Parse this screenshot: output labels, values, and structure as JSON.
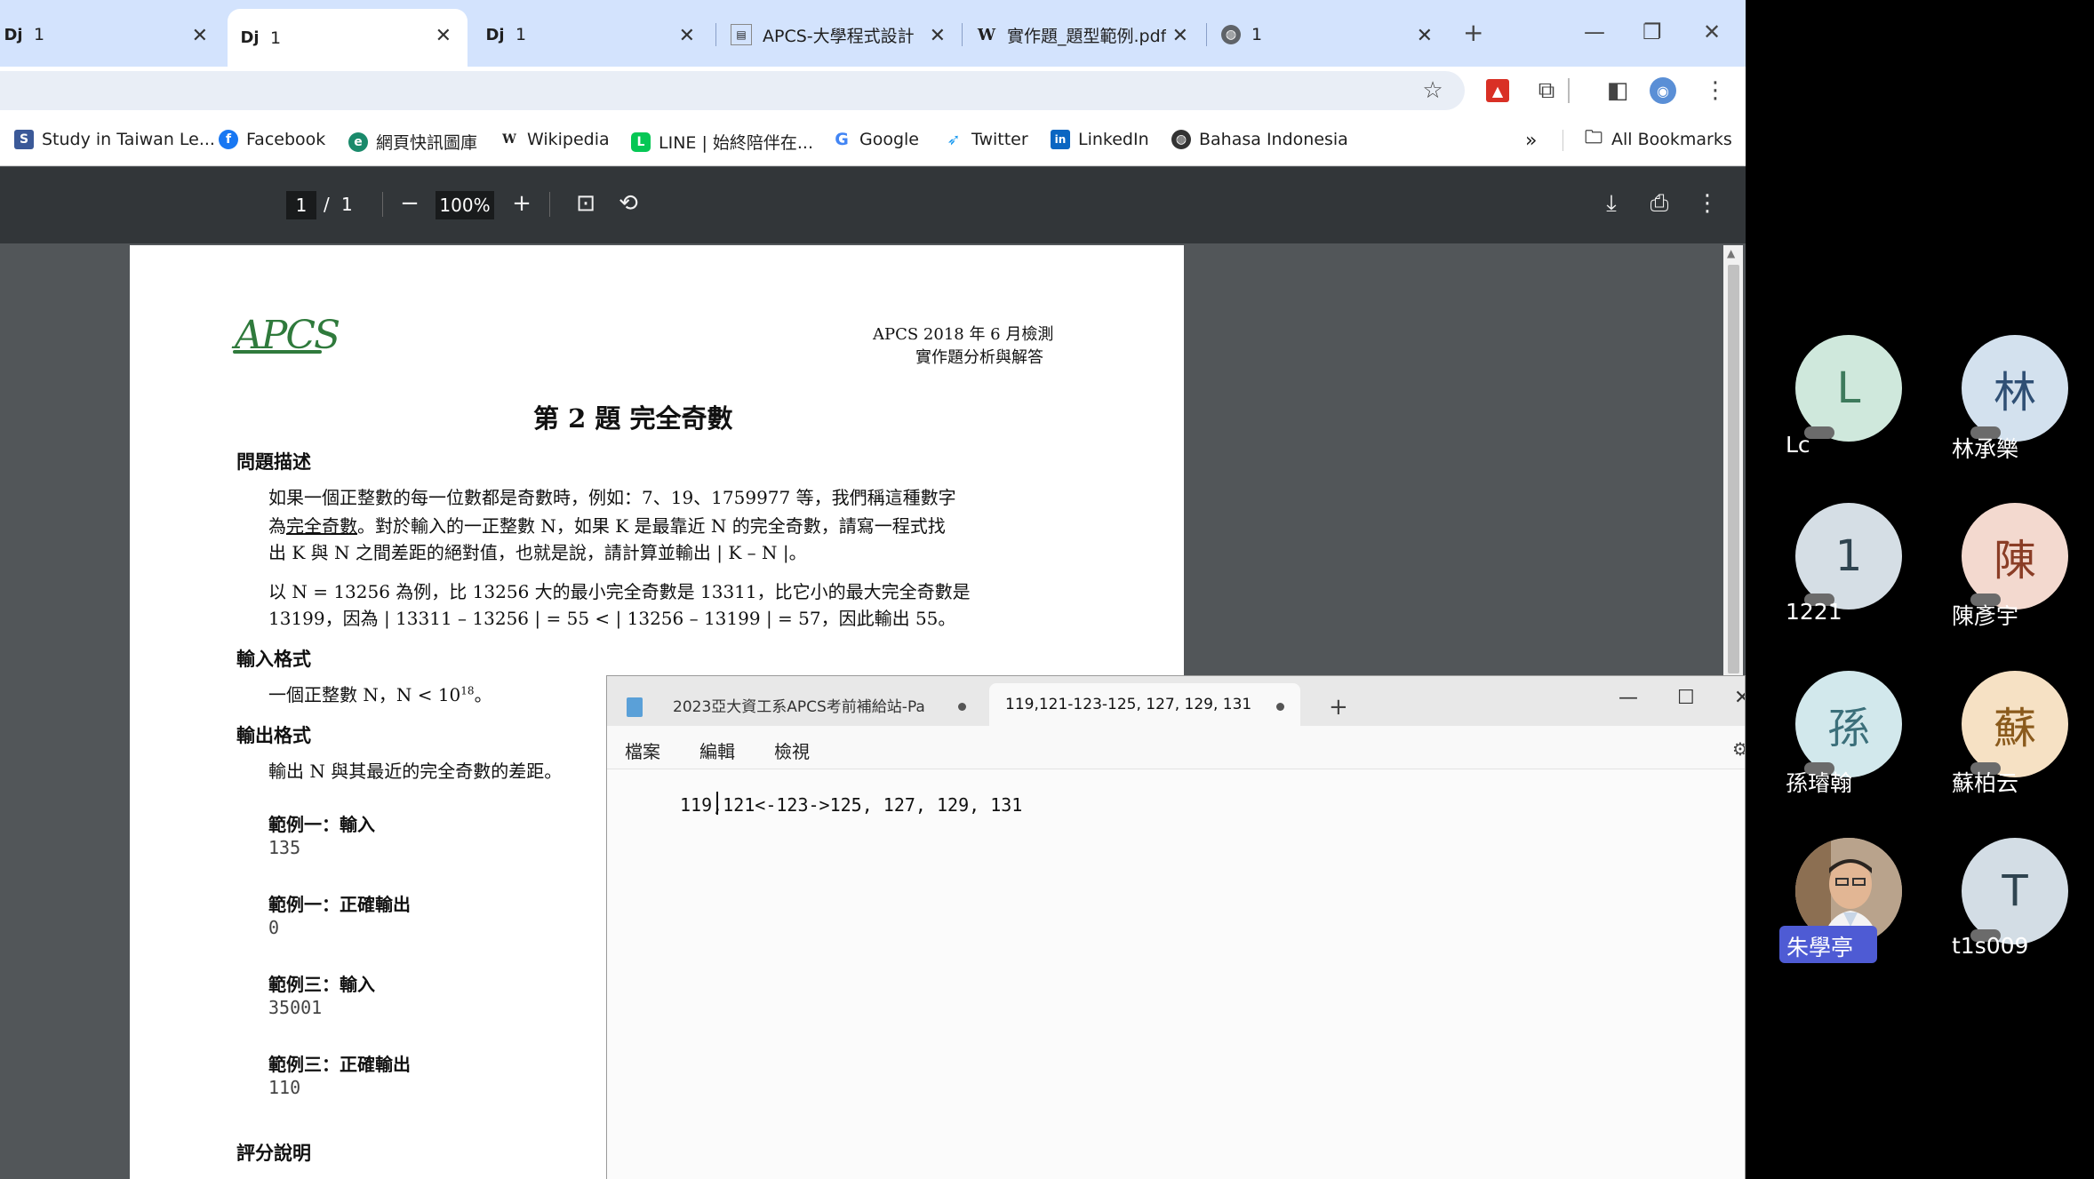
{
  "browser": {
    "tabs": [
      {
        "label": "1",
        "icon": "django-icon"
      },
      {
        "label": "1",
        "icon": "django-icon",
        "active": true
      },
      {
        "label": "1",
        "icon": "django-icon"
      },
      {
        "label": "APCS-大學程式設計",
        "icon": "apcs-icon"
      },
      {
        "label": "實作題_題型範例.pdf",
        "icon": "wordpress-icon"
      },
      {
        "label": "1",
        "icon": "globe-icon"
      }
    ],
    "new_tab": "+",
    "bookmarks": [
      {
        "label": "Study in Taiwan Le...",
        "icon": "study-icon"
      },
      {
        "label": "Facebook",
        "icon": "facebook-icon"
      },
      {
        "label": "網頁快訊圖庫",
        "icon": "edge-icon"
      },
      {
        "label": "Wikipedia",
        "icon": "wikipedia-icon"
      },
      {
        "label": "LINE | 始終陪伴在...",
        "icon": "line-icon"
      },
      {
        "label": "Google",
        "icon": "google-icon"
      },
      {
        "label": "Twitter",
        "icon": "twitter-icon"
      },
      {
        "label": "LinkedIn",
        "icon": "linkedin-icon"
      },
      {
        "label": "Bahasa Indonesia",
        "icon": "globe-icon"
      }
    ],
    "bookmarks_more": "»",
    "all_bookmarks": "All Bookmarks"
  },
  "pdf_viewer": {
    "page_current": "1",
    "page_sep": "/",
    "page_total": "1",
    "zoom": "100%"
  },
  "pdf": {
    "logo": "APCS",
    "header_line1": "APCS 2018 年 6 月檢測",
    "header_line2": "實作題分析與解答",
    "title": "第 2 題  完全奇數",
    "h_problem": "問題描述",
    "p1_line1": "如果一個正整數的每一位數都是奇數時，例如：7、19、1759977 等，我們稱這種數字",
    "p1_line2_a": "為",
    "p1_line2_u": "完全奇數",
    "p1_line2_b": "。對於輸入的一正整數 N，如果 K 是最靠近 N 的完全奇數，請寫一程式找",
    "p1_line3": "出 K 與 N 之間差距的絕對值，也就是說，請計算並輸出 | K – N |。",
    "p2_line1": "以 N = 13256 為例，比 13256 大的最小完全奇數是 13311，比它小的最大完全奇數是",
    "p2_line2": "13199，因為 | 13311 – 13256 | = 55 < | 13256 – 13199 | = 57，因此輸出 55。",
    "h_input": "輸入格式",
    "input_desc_a": "一個正整數 N，N < 10",
    "input_desc_sup": "18",
    "input_desc_b": "。",
    "h_output": "輸出格式",
    "output_desc": "輸出 N 與其最近的完全奇數的差距。",
    "ex1_in_label": "範例一：輸入",
    "ex1_in": "135",
    "ex1_out_label": "範例一：正確輸出",
    "ex1_out": "0",
    "ex3_in_label": "範例三：輸入",
    "ex3_in": "35001",
    "ex3_out_label": "範例三：正確輸出",
    "ex3_out": "110",
    "h_scoring": "評分說明"
  },
  "notepad": {
    "tab1": "2023亞大資工系APCS考前補給站-Pa",
    "tab2": "119,121-123-125, 127, 129, 131",
    "new_tab": "+",
    "menu": [
      "檔案",
      "編輯",
      "檢視"
    ],
    "content": "119,121<-123->125, 127, 129, 131"
  },
  "participants": [
    {
      "name": "Lc",
      "initial": "L",
      "bg": "#cfe8dc",
      "fg": "#3d7a5c"
    },
    {
      "name": "林承樂",
      "initial": "林",
      "bg": "#d3e1ee",
      "fg": "#2f4f74"
    },
    {
      "name": "1221",
      "initial": "1",
      "bg": "#d5dee5",
      "fg": "#2f4450"
    },
    {
      "name": "陳彥宇",
      "initial": "陳",
      "bg": "#f3d9cf",
      "fg": "#8a3d26"
    },
    {
      "name": "孫璿翰",
      "initial": "孫",
      "bg": "#d2e8ec",
      "fg": "#3b6f7a"
    },
    {
      "name": "蘇柏云",
      "initial": "蘇",
      "bg": "#f6e1c4",
      "fg": "#8a5a1c"
    },
    {
      "name": "朱學亭",
      "initial": "",
      "bg": "#c9b9a8",
      "fg": "#3a2a1c"
    },
    {
      "name": "t1s009",
      "initial": "T",
      "bg": "#d3dde5",
      "fg": "#2f4450"
    }
  ]
}
